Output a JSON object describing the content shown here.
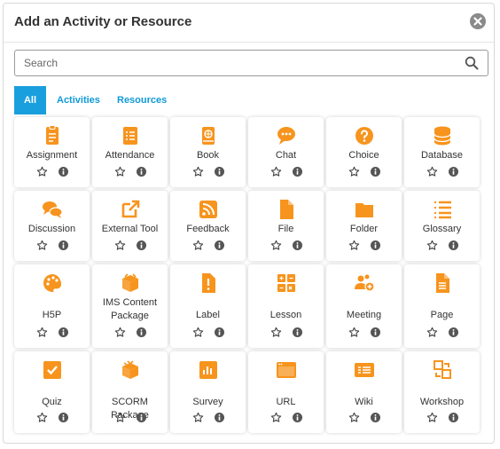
{
  "modal": {
    "title": "Add an Activity or Resource",
    "close_icon": "close-circle-icon"
  },
  "search": {
    "placeholder": "Search",
    "value": ""
  },
  "tabs": [
    {
      "label": "All",
      "active": true
    },
    {
      "label": "Activities",
      "active": false
    },
    {
      "label": "Resources",
      "active": false
    }
  ],
  "colors": {
    "accent": "#f7941d",
    "tab_active": "#1a9fde",
    "link": "#0f9ad8"
  },
  "items": [
    {
      "label": "Assignment",
      "icon": "assignment-icon"
    },
    {
      "label": "Attendance",
      "icon": "attendance-icon"
    },
    {
      "label": "Book",
      "icon": "book-icon"
    },
    {
      "label": "Chat",
      "icon": "chat-icon"
    },
    {
      "label": "Choice",
      "icon": "choice-icon"
    },
    {
      "label": "Database",
      "icon": "database-icon"
    },
    {
      "label": "Discussion",
      "icon": "discussion-icon"
    },
    {
      "label": "External Tool",
      "icon": "external-tool-icon"
    },
    {
      "label": "Feedback",
      "icon": "feedback-icon"
    },
    {
      "label": "File",
      "icon": "file-icon"
    },
    {
      "label": "Folder",
      "icon": "folder-icon"
    },
    {
      "label": "Glossary",
      "icon": "glossary-icon"
    },
    {
      "label": "H5P",
      "icon": "h5p-icon"
    },
    {
      "label": "IMS Content Package",
      "icon": "ims-package-icon"
    },
    {
      "label": "Label",
      "icon": "label-icon"
    },
    {
      "label": "Lesson",
      "icon": "lesson-icon"
    },
    {
      "label": "Meeting",
      "icon": "meeting-icon"
    },
    {
      "label": "Page",
      "icon": "page-icon"
    },
    {
      "label": "Quiz",
      "icon": "quiz-icon"
    },
    {
      "label": "SCORM Package",
      "icon": "scorm-package-icon"
    },
    {
      "label": "Survey",
      "icon": "survey-icon"
    },
    {
      "label": "URL",
      "icon": "url-icon"
    },
    {
      "label": "Wiki",
      "icon": "wiki-icon"
    },
    {
      "label": "Workshop",
      "icon": "workshop-icon"
    }
  ]
}
